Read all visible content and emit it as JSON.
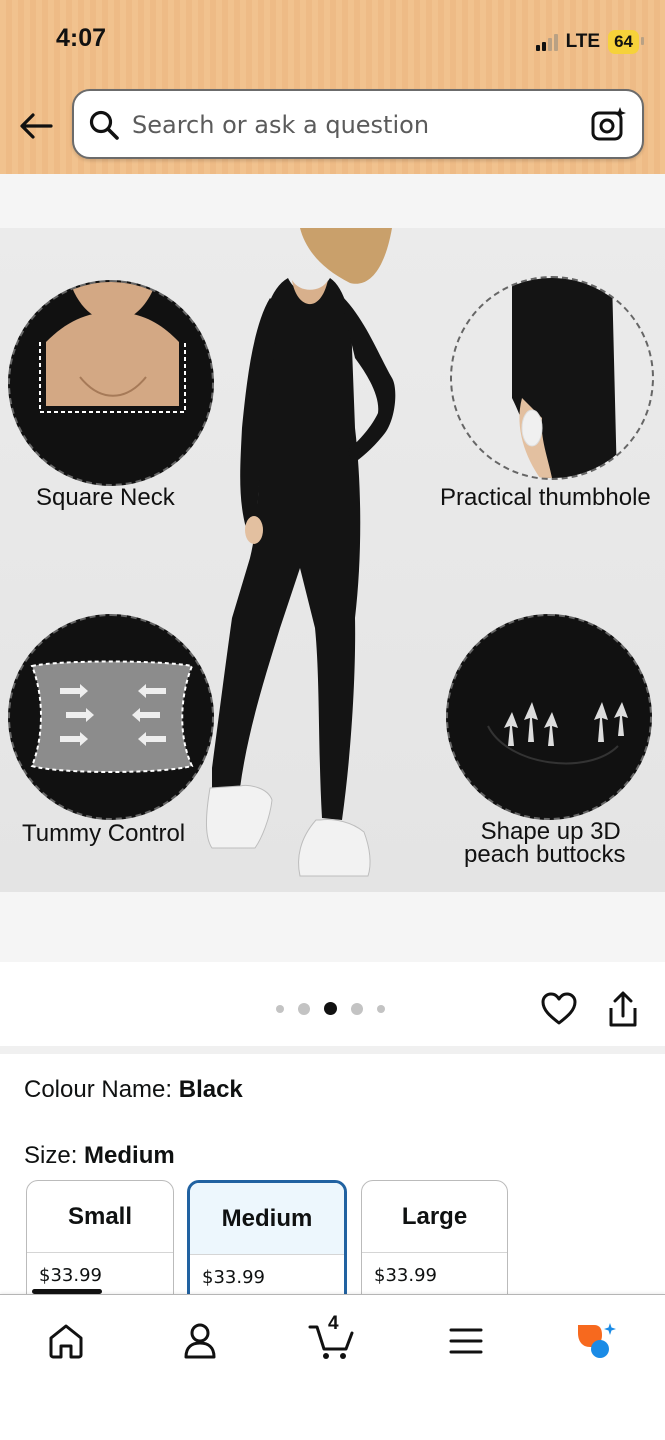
{
  "status_bar": {
    "time": "4:07",
    "network": "LTE",
    "battery": "64"
  },
  "search": {
    "placeholder": "Search or ask a question"
  },
  "image_callouts": {
    "square_neck": "Square Neck",
    "thumbhole": "Practical thumbhole",
    "tummy": "Tummy Control",
    "shape_line1": "Shape up 3D",
    "shape_line2": "peach buttocks"
  },
  "gallery": {
    "dot_count": 5,
    "active_index": 2
  },
  "colour": {
    "label": "Colour Name: ",
    "value": "Black"
  },
  "size": {
    "label": "Size: ",
    "value": "Medium",
    "options": [
      {
        "name": "Small",
        "price": "$33.99"
      },
      {
        "name": "Medium",
        "price": "$33.99"
      },
      {
        "name": "Large",
        "price": "$33.99"
      }
    ]
  },
  "bottom_nav": {
    "cart_count": "4"
  },
  "colors": {
    "header": "#f1c28e",
    "selected_border": "#2162a1",
    "rufus_orange": "#f7691e",
    "rufus_blue": "#1a8be6"
  }
}
